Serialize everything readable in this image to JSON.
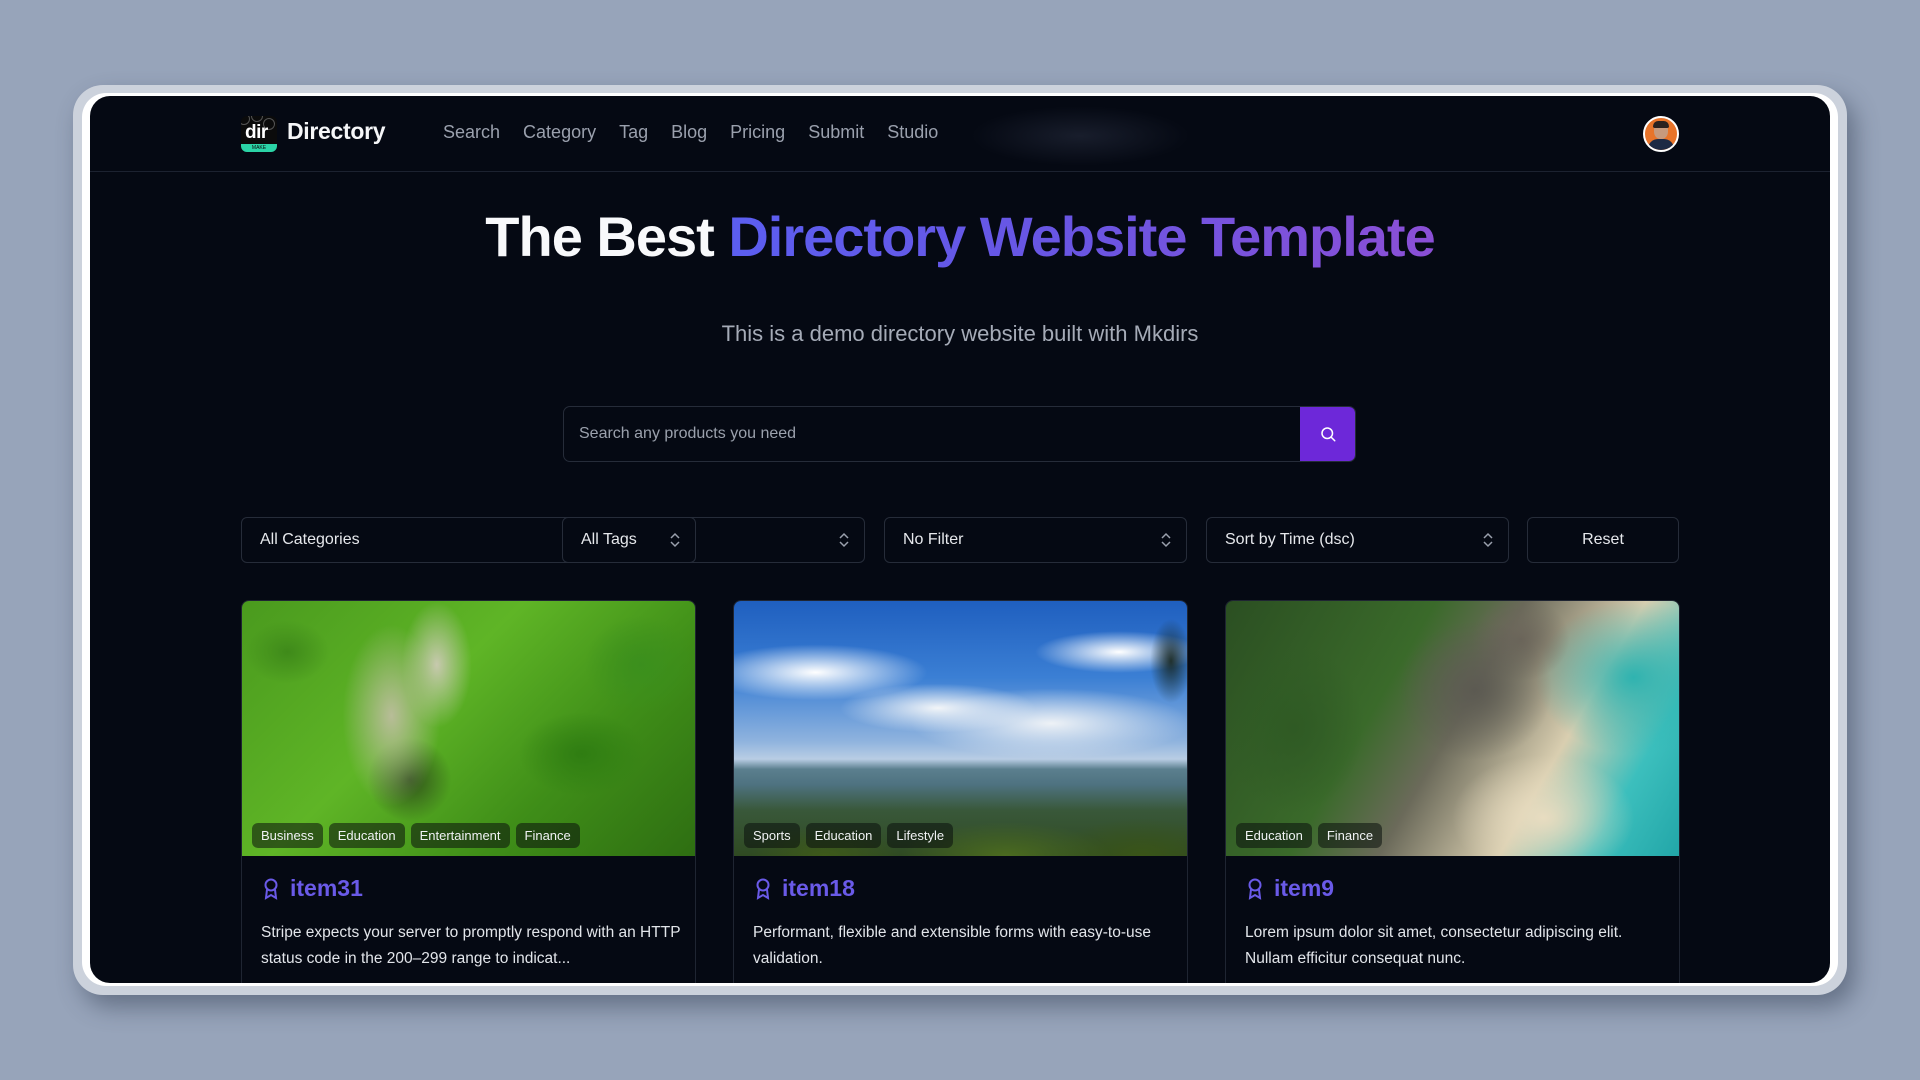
{
  "header": {
    "logo_text": "dir",
    "logo_badge": "MAKE",
    "brand": "Directory",
    "nav": [
      "Search",
      "Category",
      "Tag",
      "Blog",
      "Pricing",
      "Submit",
      "Studio"
    ]
  },
  "hero": {
    "title_plain": "The Best ",
    "title_highlight": "Directory Website Template",
    "subtitle": "This is a demo directory website built with Mkdirs",
    "gradient_colors": [
      "#5b5ef0",
      "#8b4fd6"
    ]
  },
  "search": {
    "placeholder": "Search any products you need",
    "value": "",
    "button_icon": "search-icon",
    "button_color": "#6d28d9"
  },
  "filters": {
    "category": "All Categories",
    "tag": "All Tags",
    "filter": "No Filter",
    "sort": "Sort by Time (dsc)",
    "reset_label": "Reset"
  },
  "items": [
    {
      "title": "item31",
      "icon": "award-icon",
      "tags": [
        "Business",
        "Education",
        "Entertainment",
        "Finance"
      ],
      "description": "Stripe expects your server to promptly respond with an HTTP status code in the 200–299 range to indicat...",
      "image": "aerial-forest-river"
    },
    {
      "title": "item18",
      "icon": "award-icon",
      "tags": [
        "Sports",
        "Education",
        "Lifestyle"
      ],
      "description": "Performant, flexible and extensible forms with easy-to-use validation.",
      "image": "sky-mountains"
    },
    {
      "title": "item9",
      "icon": "award-icon",
      "tags": [
        "Education",
        "Finance"
      ],
      "description": "Lorem ipsum dolor sit amet, consectetur adipiscing elit. Nullam efficitur consequat nunc.",
      "image": "beach-rocks-aerial"
    }
  ],
  "colors": {
    "page_bg": "#97a4ba",
    "screen_bg": "#050913",
    "accent": "#6a5ae8"
  }
}
